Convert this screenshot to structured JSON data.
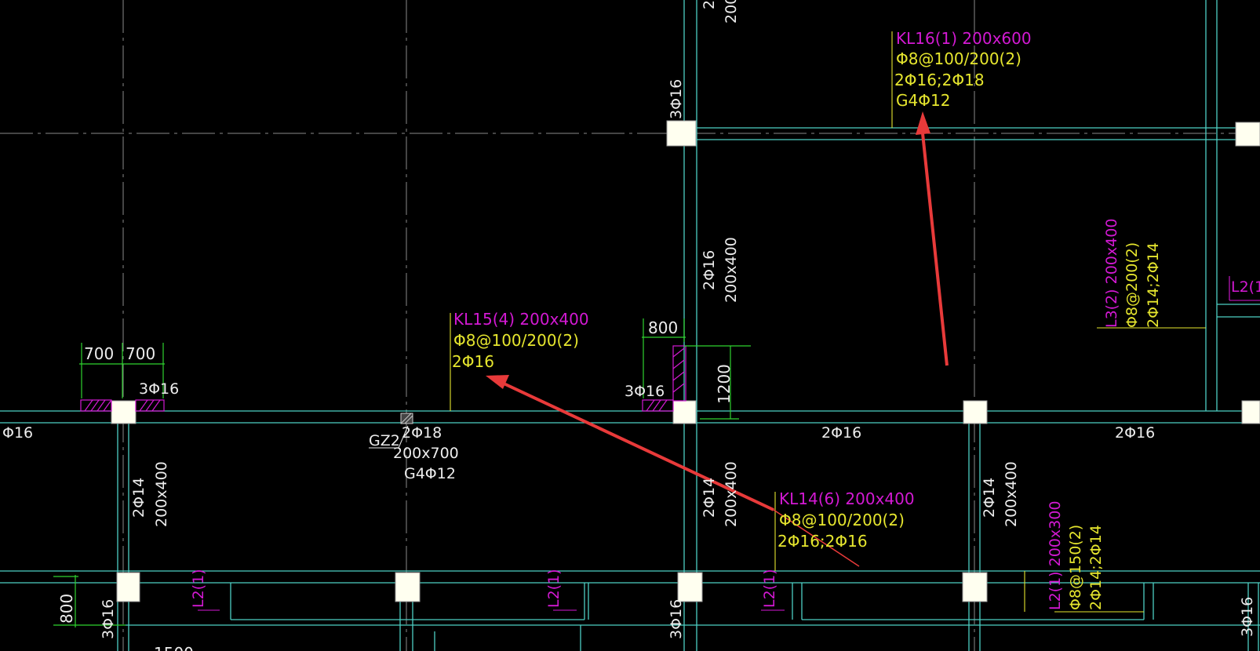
{
  "colors": {
    "background": "#000000",
    "beam_line": "#4ECFC4",
    "grid_axis": "#9A9A9A",
    "beam_label": "#D319D3",
    "rebar_text": "#E6E62E",
    "dimension": "#2FD32F",
    "annotation_text": "#EDEDED",
    "column_fill": "#FFFFF0",
    "callout_arrow": "#E83A3A"
  },
  "beam_annotations": {
    "kl16": {
      "label": "KL16(1) 200x600",
      "stirrup": "Φ8@100/200(2)",
      "main_bars": "2Φ16;2Φ18",
      "side_bars": "G4Φ12"
    },
    "kl15": {
      "label": "KL15(4) 200x400",
      "stirrup": "Φ8@100/200(2)",
      "main_bars": "2Φ16"
    },
    "kl14": {
      "label": "KL14(6) 200x400",
      "stirrup": "Φ8@100/200(2)",
      "main_bars": "2Φ16;2Φ16"
    },
    "l3": {
      "label": "L3(2) 200x400",
      "stirrup": "Φ8@200(2)",
      "main_bars": "2Φ14;2Φ14"
    },
    "l2_lower_right": {
      "label": "L2(1) 200x300",
      "stirrup": "Φ8@150(2)",
      "main_bars": "2Φ14;2Φ14"
    },
    "l2_short": "L2(1)",
    "l2_cut": "L2(1"
  },
  "column_annotation": {
    "id": "GZ2",
    "bars": "2Φ18",
    "size": "200x700",
    "side_bars": "G4Φ12"
  },
  "rebar_labels": {
    "three_phi_16": "3Φ16",
    "two_phi_16": "2Φ16",
    "two_phi_14": "2Φ14",
    "edge_phi_16": "Φ16",
    "top_cut": "2"
  },
  "section_labels": {
    "size_200x400": "200x400",
    "size_200": "200"
  },
  "dimensions": {
    "dim_700": "700",
    "dim_800": "800",
    "dim_1200": "1200",
    "bottom_cut": "1500"
  }
}
